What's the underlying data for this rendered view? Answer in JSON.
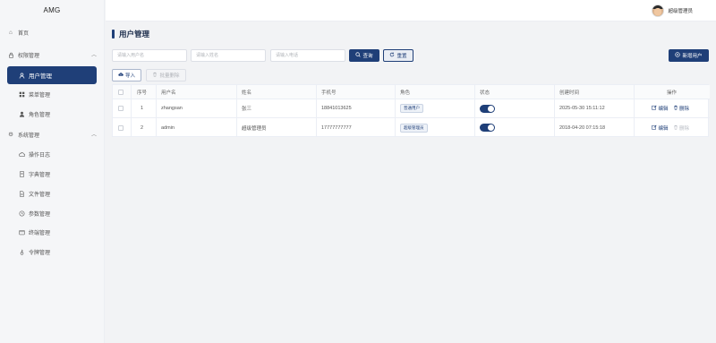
{
  "app": {
    "logo": "AMG"
  },
  "sidebar": {
    "items": [
      {
        "label": "首页",
        "icon": "home-icon"
      },
      {
        "label": "权限管理",
        "icon": "lock-icon",
        "expanded": true
      },
      {
        "label": "用户管理",
        "icon": "user-icon",
        "active": true
      },
      {
        "label": "菜单管理",
        "icon": "grid-icon"
      },
      {
        "label": "角色管理",
        "icon": "person-icon"
      },
      {
        "label": "系统管理",
        "icon": "gear-icon",
        "expanded": true
      },
      {
        "label": "操作日志",
        "icon": "cloud-icon"
      },
      {
        "label": "字典管理",
        "icon": "book-icon"
      },
      {
        "label": "文件管理",
        "icon": "file-icon"
      },
      {
        "label": "参数管理",
        "icon": "clock-icon"
      },
      {
        "label": "终端管理",
        "icon": "terminal-icon"
      },
      {
        "label": "令牌管理",
        "icon": "key-icon"
      }
    ]
  },
  "header": {
    "user_name": "超级管理员"
  },
  "page": {
    "title": "用户管理"
  },
  "search": {
    "username_placeholder": "请输入用户名",
    "name_placeholder": "请输入姓名",
    "phone_placeholder": "请输入电话",
    "query_label": "查询",
    "reset_label": "重置",
    "add_label": "新增用户"
  },
  "toolbar": {
    "import_label": "导入",
    "batch_delete_label": "批量删除"
  },
  "table": {
    "columns": [
      "序号",
      "用户名",
      "姓名",
      "手机号",
      "角色",
      "状态",
      "创建时间",
      "操作"
    ],
    "rows": [
      {
        "index": "1",
        "username": "zhangsan",
        "name": "张三",
        "phone": "18841013625",
        "role": "普通用户",
        "status_on": true,
        "created": "2025-05-30 15:11:12",
        "edit": "编辑",
        "delete": "删除",
        "delete_disabled": false
      },
      {
        "index": "2",
        "username": "admin",
        "name": "超级管理员",
        "phone": "17777777777",
        "role": "超级管理员",
        "status_on": true,
        "created": "2018-04-20 07:15:18",
        "edit": "编辑",
        "delete": "删除",
        "delete_disabled": true
      }
    ]
  },
  "colors": {
    "primary": "#1f3f78",
    "sidebar_bg": "#f5f6f8",
    "page_bg": "#f2f3f5"
  }
}
